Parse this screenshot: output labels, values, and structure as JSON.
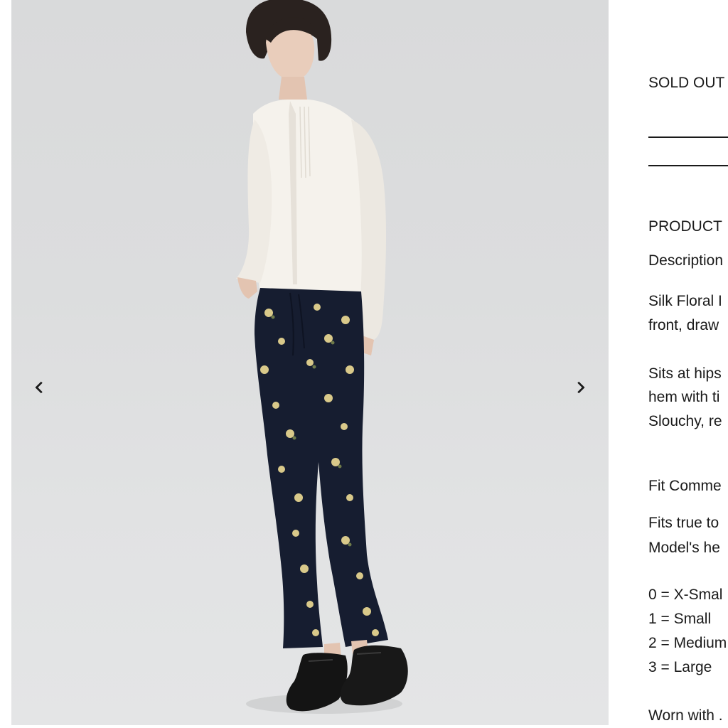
{
  "gallery": {
    "prev_label": "Previous image",
    "next_label": "Next image",
    "arrow_color": "#1a1a1a",
    "icons": {
      "prev": "chevron-left-icon",
      "next": "chevron-right-icon"
    }
  },
  "product": {
    "status": "SOLD OUT",
    "size_select_value": "",
    "section_heading": "PRODUCT",
    "description_heading": "Description",
    "description_lines": [
      "Silk Floral I",
      "front, draw",
      "Sits at hips",
      "hem with ti",
      "Slouchy, re"
    ],
    "fit_heading": "Fit Comme",
    "fit_lines": [
      "Fits true to",
      "Model's he"
    ],
    "size_lines": [
      "0 = X-Smal",
      "1 = Small",
      "2 = Medium",
      "3 = Large"
    ],
    "worn_with": "Worn with ."
  }
}
